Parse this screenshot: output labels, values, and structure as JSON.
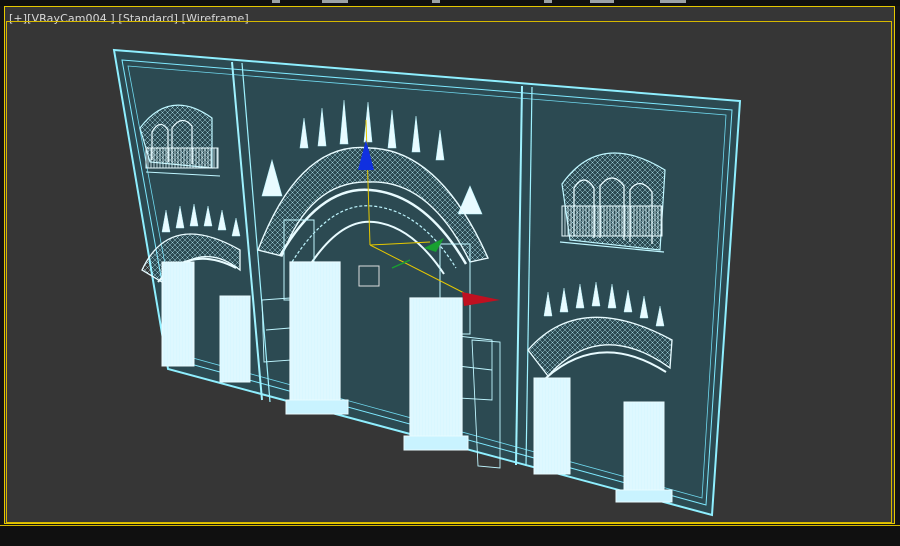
{
  "viewport": {
    "label_parts": [
      "[+]",
      "[VRayCam004 ]",
      "[Standard]",
      "[Wireframe]"
    ]
  },
  "colors": {
    "viewport_bg": "#363636",
    "wire_cyan": "#7fe9ff",
    "wire_bright": "#e8fbff",
    "panel_fill": "#2f4f57",
    "active_border": "#e6c800",
    "gizmo_z": "#1030e0",
    "gizmo_y": "#18a030",
    "gizmo_x": "#c01020"
  },
  "icons": [
    "gizmo-z-arrow-icon",
    "gizmo-y-arrow-icon",
    "gizmo-x-arrow-icon",
    "gizmo-center-box-icon"
  ]
}
